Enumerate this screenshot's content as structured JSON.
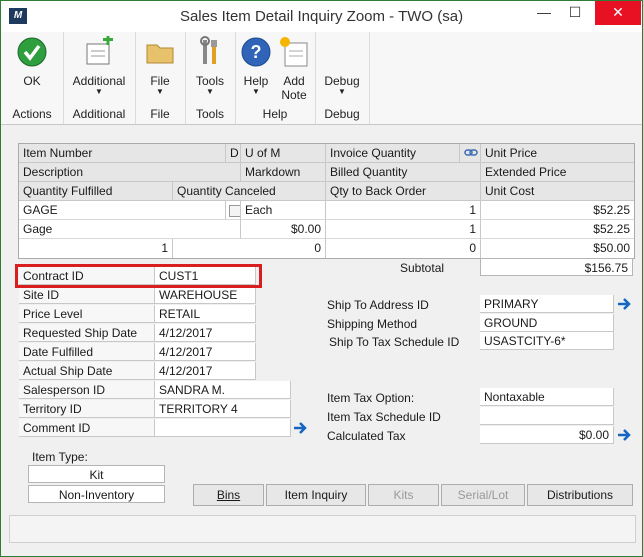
{
  "window": {
    "title": "Sales Item Detail Inquiry Zoom  -  TWO (sa)",
    "app_icon_label": "M"
  },
  "title_buttons": {
    "minimize": "—",
    "maximize": "☐",
    "close": "✕"
  },
  "ribbon": {
    "groups": [
      {
        "label": "Actions",
        "buttons": [
          {
            "label": "OK",
            "icon": "ok-check-icon"
          }
        ]
      },
      {
        "label": "Additional",
        "buttons": [
          {
            "label": "Additional",
            "icon": "additional-icon",
            "caret": "▼"
          }
        ]
      },
      {
        "label": "File",
        "buttons": [
          {
            "label": "File",
            "icon": "folder-icon",
            "caret": "▼"
          }
        ]
      },
      {
        "label": "Tools",
        "buttons": [
          {
            "label": "Tools",
            "icon": "tools-icon",
            "caret": "▼"
          }
        ]
      },
      {
        "label": "Help",
        "buttons": [
          {
            "label": "Help",
            "icon": "help-icon",
            "caret": "▼"
          },
          {
            "label": "Add",
            "label2": "Note",
            "icon": "add-note-icon"
          }
        ]
      },
      {
        "label": "Debug",
        "buttons": [
          {
            "label": "Debug",
            "icon": "debug-icon",
            "caret": "▼"
          }
        ]
      }
    ]
  },
  "grid": {
    "header_row1": {
      "item_number": "Item Number",
      "d": "D",
      "u_of_m": "U of M",
      "invoice_quantity": "Invoice Quantity",
      "unit_price": "Unit Price"
    },
    "header_row2": {
      "description": "Description",
      "markdown": "Markdown",
      "billed_quantity": "Billed Quantity",
      "extended_price": "Extended Price"
    },
    "header_row3": {
      "quantity_fulfilled": "Quantity Fulfilled",
      "quantity_canceled": "Quantity Canceled",
      "qty_to_back_order": "Qty to Back Order",
      "unit_cost": "Unit Cost"
    },
    "row1": {
      "item_number": "GAGE",
      "u_of_m": "Each",
      "invoice_quantity": "1",
      "unit_price": "$52.25"
    },
    "row2": {
      "description": "Gage",
      "markdown": "$0.00",
      "billed_quantity": "1",
      "extended_price": "$52.25"
    },
    "row3": {
      "quantity_fulfilled": "1",
      "quantity_canceled": "0",
      "qty_to_back_order": "0",
      "unit_cost": "$50.00"
    }
  },
  "subtotal": {
    "label": "Subtotal",
    "value": "$156.75"
  },
  "left_fields": [
    {
      "label": "Contract ID",
      "value": "CUST1"
    },
    {
      "label": "Site ID",
      "value": "WAREHOUSE"
    },
    {
      "label": "Price Level",
      "value": "RETAIL"
    },
    {
      "label": "Requested Ship Date",
      "value": "4/12/2017"
    },
    {
      "label": "Date Fulfilled",
      "value": "4/12/2017"
    },
    {
      "label": "Actual Ship Date",
      "value": "4/12/2017"
    },
    {
      "label": "Salesperson ID",
      "value": "SANDRA M."
    },
    {
      "label": "Territory ID",
      "value": "TERRITORY 4"
    },
    {
      "label": "Comment ID",
      "value": ""
    }
  ],
  "right_fields": {
    "ship_to_address": {
      "label": "Ship To Address ID",
      "value": "PRIMARY"
    },
    "shipping_method": {
      "label": "Shipping Method",
      "value": "GROUND"
    },
    "ship_to_tax": {
      "label": "Ship To Tax Schedule ID",
      "value": "USASTCITY-6*"
    },
    "item_tax_option": {
      "label": "Item Tax Option:",
      "value": "Nontaxable"
    },
    "item_tax_schedule": {
      "label": "Item Tax Schedule ID",
      "value": ""
    },
    "calculated_tax": {
      "label": "Calculated Tax",
      "value": "$0.00"
    }
  },
  "item_type": {
    "label": "Item Type:",
    "values": [
      "Kit",
      "Non-Inventory"
    ]
  },
  "buttons": {
    "bins": "Bins",
    "item_inquiry": "Item Inquiry",
    "kits": "Kits",
    "serial_lot": "Serial/Lot",
    "distributions": "Distributions"
  },
  "colors": {
    "accent_green": "#2e7d32",
    "highlight_red": "#d81e1e",
    "arrow_blue": "#1565c0",
    "close_red": "#e81123"
  }
}
